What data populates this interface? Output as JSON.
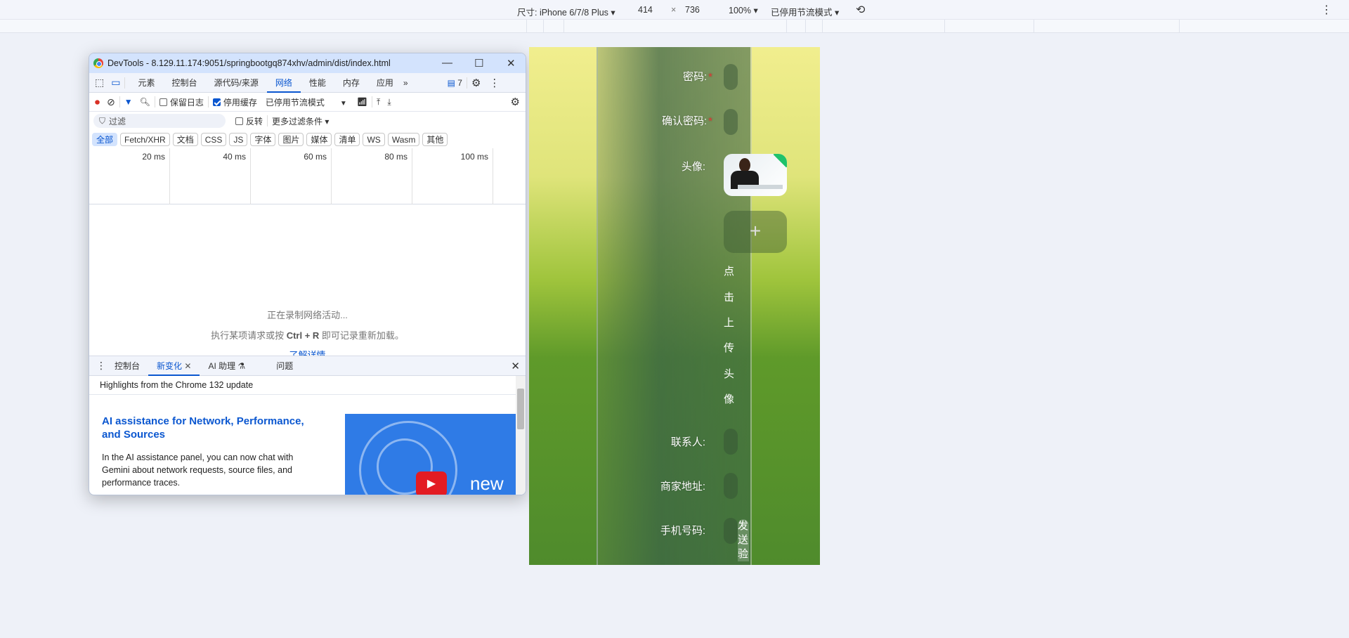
{
  "device_toolbar": {
    "dimensions_label": "尺寸: iPhone 6/7/8 Plus",
    "width": "414",
    "times": "×",
    "height": "736",
    "zoom": "100%",
    "throttle": "已停用节流模式"
  },
  "devtools": {
    "title": "DevTools - 8.129.11.174:9051/springbootgq874xhv/admin/dist/index.html",
    "tabs": [
      "元素",
      "控制台",
      "源代码/来源",
      "网络",
      "性能",
      "内存",
      "应用"
    ],
    "active_tab": "网络",
    "issues_count": "7",
    "toolbar": {
      "preserve_log": "保留日志",
      "disable_cache": "停用缓存",
      "disable_cache_checked": true,
      "throttle": "已停用节流模式"
    },
    "filter": {
      "placeholder": "过滤",
      "invert": "反转",
      "more_filters": "更多过滤条件"
    },
    "type_chips": [
      "全部",
      "Fetch/XHR",
      "文档",
      "CSS",
      "JS",
      "字体",
      "图片",
      "媒体",
      "清单",
      "WS",
      "Wasm",
      "其他"
    ],
    "timeline_ticks": [
      "20 ms",
      "40 ms",
      "60 ms",
      "80 ms",
      "100 ms"
    ],
    "empty": {
      "line1": "正在录制网络活动...",
      "line2_pre": "执行某项请求或按 ",
      "line2_key": "Ctrl + R",
      "line2_post": " 即可记录重新加载。",
      "link": "了解详情"
    },
    "drawer_tabs": [
      "控制台",
      "新变化",
      "AI 助理",
      "问题"
    ],
    "drawer_active": "新变化",
    "highlights": "Highlights from the Chrome 132 update",
    "article": {
      "title": "AI assistance for Network, Performance, and Sources",
      "body": "In the AI assistance panel, you can now chat with Gemini about network requests, source files, and performance traces.",
      "thumb_text": "new"
    }
  },
  "form": {
    "password": "密码:",
    "confirm_password": "确认密码:",
    "avatar": "头像:",
    "upload_hint": [
      "点",
      "击",
      "上",
      "传",
      "头",
      "像"
    ],
    "contact": "联系人:",
    "address": "商家地址:",
    "phone": "手机号码:",
    "send_code": [
      "发",
      "送",
      "验"
    ],
    "required_mark": "*"
  }
}
